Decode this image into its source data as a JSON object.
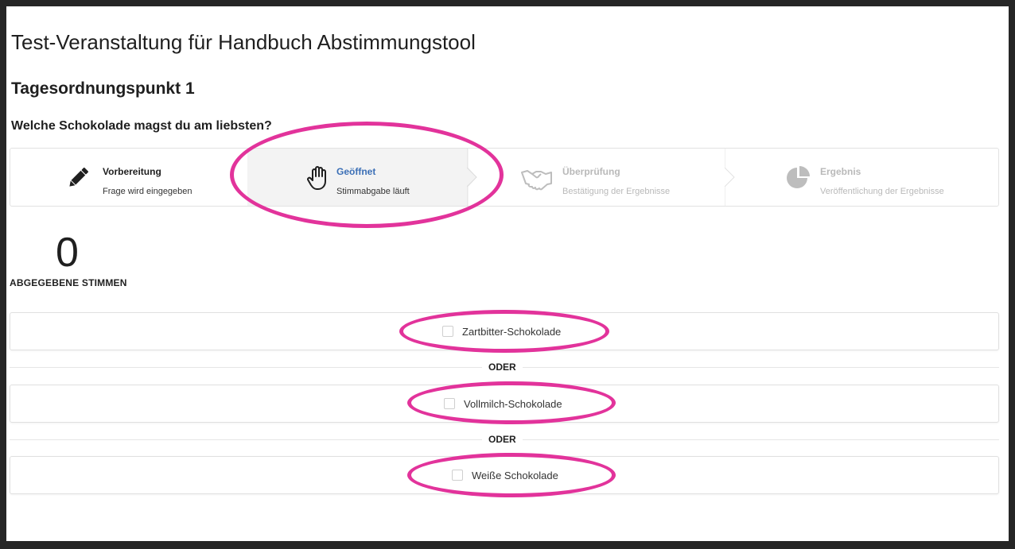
{
  "event": {
    "title": "Test-Veranstaltung für Handbuch Abstimmungstool"
  },
  "agenda": {
    "title": "Tagesordnungspunkt 1"
  },
  "question": {
    "text": "Welche Schokolade magst du am liebsten?"
  },
  "steps": [
    {
      "label": "Vorbereitung",
      "sub": "Frage wird eingegeben",
      "icon": "pencil-icon",
      "state": "done"
    },
    {
      "label": "Geöffnet",
      "sub": "Stimmabgabe läuft",
      "icon": "hand-icon",
      "state": "active"
    },
    {
      "label": "Überprüfung",
      "sub": "Bestätigung der Ergebnisse",
      "icon": "handshake-icon",
      "state": "pending"
    },
    {
      "label": "Ergebnis",
      "sub": "Veröffentlichung der Ergebnisse",
      "icon": "pie-chart-icon",
      "state": "pending"
    }
  ],
  "votes": {
    "count": "0",
    "label": "ABGEGEBENE STIMMEN"
  },
  "options": [
    {
      "label": "Zartbitter-Schokolade",
      "checked": false
    },
    {
      "label": "Vollmilch-Schokolade",
      "checked": false
    },
    {
      "label": "Weiße Schokolade",
      "checked": false
    }
  ],
  "separator": {
    "label": "ODER"
  },
  "colors": {
    "highlight": "#e2339b",
    "active_step": "#3b6fb6",
    "dim_text": "#b9b9b9",
    "frame": "#262626"
  }
}
